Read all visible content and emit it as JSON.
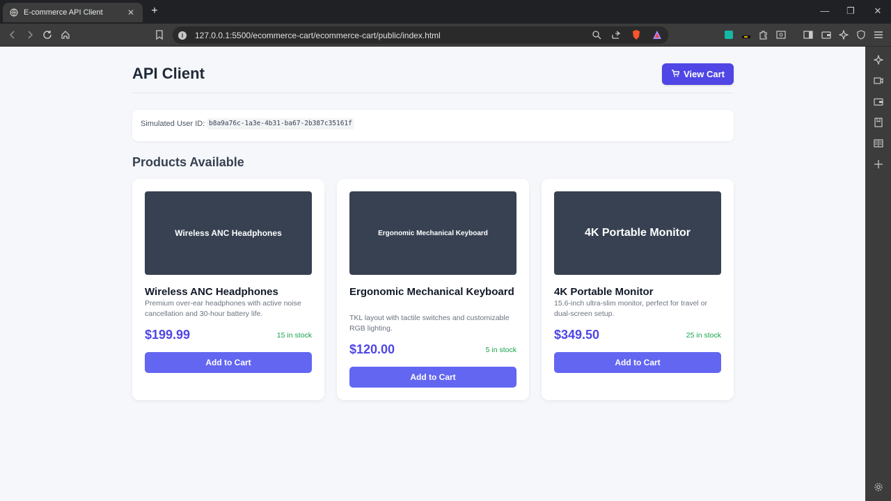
{
  "browser": {
    "tab_title": "E-commerce API Client",
    "url": "127.0.0.1:5500/ecommerce-cart/ecommerce-cart/public/index.html"
  },
  "header": {
    "title": "API Client",
    "view_cart_label": "View Cart"
  },
  "user": {
    "label": "Simulated User ID:",
    "id": "b8a9a76c-1a3e-4b31-ba67-2b387c35161f"
  },
  "section_title": "Products Available",
  "products": [
    {
      "image_text": "Wireless ANC Headphones",
      "name": "Wireless ANC Headphones",
      "description": "Premium over-ear headphones with active noise cancellation and 30-hour battery life.",
      "price": "$199.99",
      "stock": "15 in stock",
      "button": "Add to Cart"
    },
    {
      "image_text": "Ergonomic Mechanical Keyboard",
      "name": "Ergonomic Mechanical Keyboard",
      "description": "TKL layout with tactile switches and customizable RGB lighting.",
      "price": "$120.00",
      "stock": "5 in stock",
      "button": "Add to Cart"
    },
    {
      "image_text": "4K Portable Monitor",
      "name": "4K Portable Monitor",
      "description": "15.6-inch ultra-slim monitor, perfect for travel or dual-screen setup.",
      "price": "$349.50",
      "stock": "25 in stock",
      "button": "Add to Cart"
    }
  ],
  "colors": {
    "accent": "#4f46e5",
    "button": "#6366f1",
    "image_bg": "#374151",
    "stock": "#16a34a",
    "page_bg": "#f5f7fa"
  }
}
